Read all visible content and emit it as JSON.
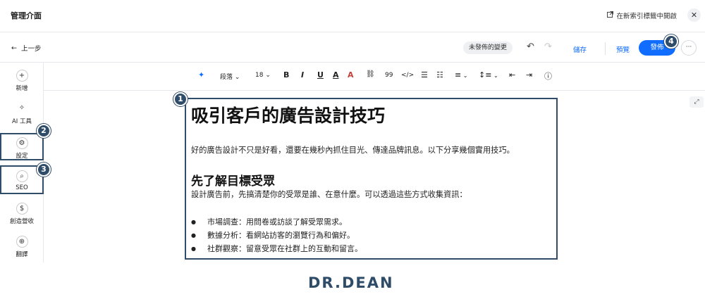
{
  "header": {
    "title": "管理介面",
    "open_in_new_tab": "在新索引標籤中開啟",
    "close": "✕"
  },
  "actionbar": {
    "back": "上一步",
    "unpublished_badge": "未發佈的變更",
    "save": "儲存",
    "preview": "預覽",
    "publish": "發佈",
    "more": "···"
  },
  "sidebar": {
    "items": [
      {
        "label": "新增",
        "icon": "plus-icon",
        "glyph": "+"
      },
      {
        "label": "AI 工具",
        "icon": "sparkle-icon",
        "glyph": "✧"
      },
      {
        "label": "設定",
        "icon": "gear-icon",
        "glyph": "⚙"
      },
      {
        "label": "SEO",
        "icon": "search-icon",
        "glyph": "⌕"
      },
      {
        "label": "創造營收",
        "icon": "dollar-icon",
        "glyph": "$"
      },
      {
        "label": "翻譯",
        "icon": "globe-icon",
        "glyph": "⊕"
      }
    ]
  },
  "toolbar": {
    "paragraph_style": "段落",
    "font_size": "18",
    "bold": "B",
    "italic": "I",
    "underline": "U",
    "text_color": "A",
    "highlight": "A",
    "link": "🔗",
    "quote": "99",
    "code": "</>",
    "info": "ⓘ"
  },
  "content": {
    "title": "吸引客戶的廣告設計技巧",
    "intro": "好的廣告設計不只是好看，還要在幾秒內抓住目光、傳達品牌訊息。以下分享幾個實用技巧。",
    "section_heading": "先了解目標受眾",
    "section_text": "設計廣告前，先搞清楚你的受眾是誰、在意什麼。可以透過這些方式收集資訊：",
    "bullets": [
      "市場調查：用問卷或訪談了解受眾需求。",
      "數據分析：看網站訪客的瀏覽行為和偏好。",
      "社群觀察：留意受眾在社群上的互動和留言。"
    ]
  },
  "markers": [
    "1",
    "2",
    "3",
    "4"
  ],
  "watermark": "DR.DEAN",
  "colors": {
    "accent": "#116dff",
    "annotation": "#2f4c68"
  }
}
